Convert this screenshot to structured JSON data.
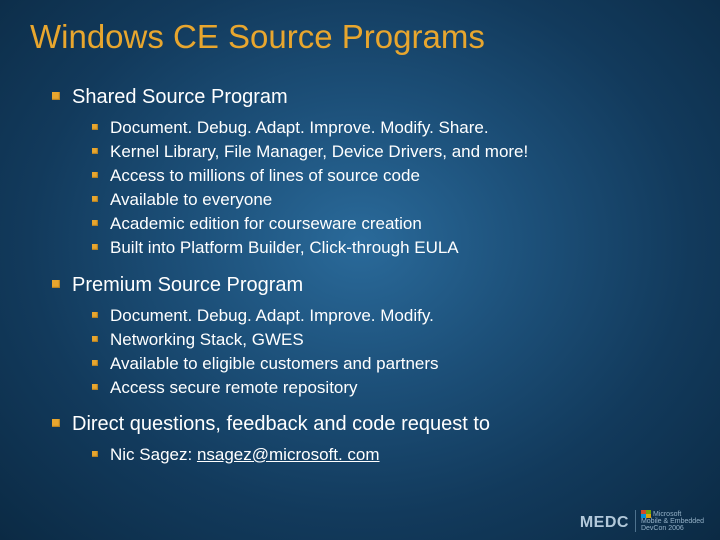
{
  "title": "Windows CE Source Programs",
  "sections": [
    {
      "heading": "Shared Source Program",
      "items": [
        "Document. Debug. Adapt. Improve. Modify. Share.",
        "Kernel Library, File Manager, Device Drivers, and more!",
        "Access to millions of lines of source code",
        "Available to everyone",
        "Academic edition for courseware creation",
        "Built into Platform Builder, Click-through EULA"
      ]
    },
    {
      "heading": "Premium Source Program",
      "items": [
        "Document. Debug. Adapt. Improve. Modify.",
        "Networking Stack, GWES",
        "Available to eligible customers and partners",
        "Access secure remote repository"
      ]
    }
  ],
  "contact": {
    "heading": "Direct questions, feedback and code request to",
    "name": "Nic Sagez: ",
    "email": "nsagez@microsoft. com"
  },
  "footer": {
    "medc": "MEDC",
    "brand_top": "Microsoft",
    "brand_mid": "Mobile & Embedded",
    "brand_bot": "DevCon 2006"
  }
}
